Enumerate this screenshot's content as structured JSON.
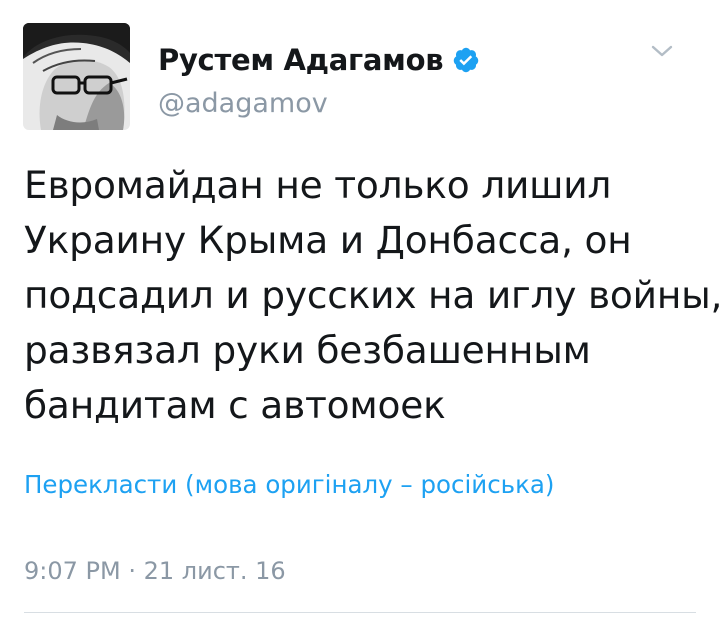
{
  "tweet": {
    "author": {
      "display_name": "Рустем Адагамов",
      "handle": "@adagamov",
      "verified": true,
      "avatar_icon": "user-avatar-photo",
      "verified_icon": "verified-badge-icon"
    },
    "menu_icon": "chevron-down-icon",
    "text_lines": [
      "Евромайдан не только лишил",
      "Украину Крыма и Донбасса, он",
      "подсадил и русских на иглу войны,",
      "развязал руки безбашенным",
      "бандитам с автомоек"
    ],
    "translate_label": "Перекласти (мова оригіналу – російська)",
    "timestamp": "9:07 PM · 21 лист. 16"
  },
  "colors": {
    "text": "#14171a",
    "secondary": "#8b98a5",
    "link": "#1da1f2",
    "verified": "#1da1f2",
    "divider": "#d8dee3"
  }
}
